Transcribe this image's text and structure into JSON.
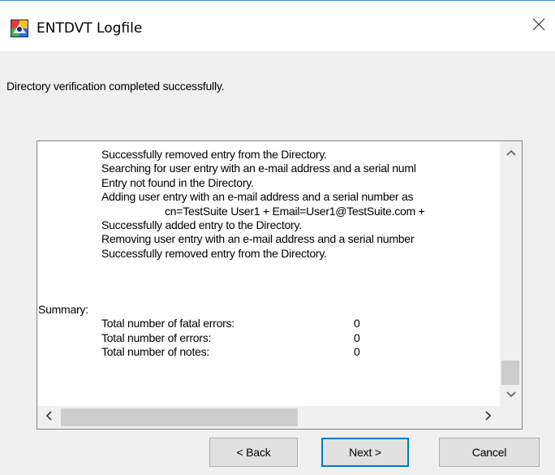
{
  "window": {
    "title": "ENTDVT Logfile"
  },
  "status_message": "Directory verification completed successfully.",
  "log": {
    "lines": [
      {
        "indent": 2,
        "text": "Successfully removed entry from the Directory."
      },
      {
        "indent": 2,
        "text": "Searching for user entry with an e-mail address and a serial numl"
      },
      {
        "indent": 2,
        "text": "Entry not found in the Directory."
      },
      {
        "indent": 2,
        "text": "Adding user entry with an e-mail address and a serial number as"
      },
      {
        "indent": 3,
        "text": "cn=TestSuite User1 + Email=User1@TestSuite.com +"
      },
      {
        "indent": 2,
        "text": "Successfully added entry to the Directory."
      },
      {
        "indent": 2,
        "text": "Removing user entry with an e-mail address and a serial number"
      },
      {
        "indent": 2,
        "text": "Successfully removed entry from the Directory."
      }
    ],
    "summary_heading": "Summary:",
    "summary_rows": [
      {
        "label": "Total number of fatal errors:",
        "value": "0"
      },
      {
        "label": "Total number of errors:",
        "value": "0"
      },
      {
        "label": "Total number of notes:",
        "value": "0"
      }
    ]
  },
  "buttons": {
    "back": "< Back",
    "next": "Next >",
    "cancel": "Cancel"
  },
  "icons": {
    "app": "entdvt-app-icon",
    "close": "close-icon",
    "scroll_up": "chevron-up-icon",
    "scroll_down": "chevron-down-icon",
    "scroll_left": "chevron-left-icon",
    "scroll_right": "chevron-right-icon"
  },
  "colors": {
    "accent": "#0078d7",
    "window_bg": "#f0f0f0",
    "scroll_thumb": "#cdcdcd"
  }
}
